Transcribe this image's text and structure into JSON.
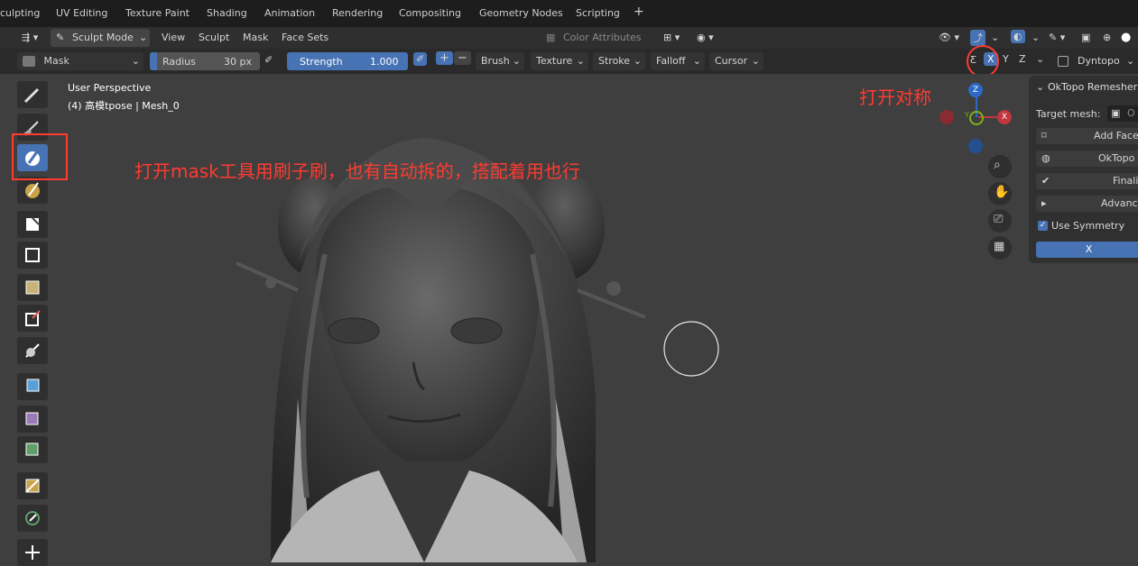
{
  "tabs": [
    "culpting",
    "UV Editing",
    "Texture Paint",
    "Shading",
    "Animation",
    "Rendering",
    "Compositing",
    "Geometry Nodes",
    "Scripting",
    "+"
  ],
  "header": {
    "mode": "Sculpt Mode",
    "menus": [
      "View",
      "Sculpt",
      "Mask",
      "Face Sets"
    ],
    "color_attributes": "Color Attributes"
  },
  "tool_header": {
    "brush_name": "Mask",
    "radius_label": "Radius",
    "radius_value": "30 px",
    "strength_label": "Strength",
    "strength_value": "1.000",
    "plus": "+",
    "minus": "−",
    "dropdowns": [
      "Brush",
      "Texture",
      "Stroke",
      "Falloff",
      "Cursor"
    ],
    "sym_x": "X",
    "sym_y": "Y",
    "sym_z": "Z",
    "dyntopo": "Dyntopo"
  },
  "viewport": {
    "perspective": "User Perspective",
    "object": "(4) 高模tpose | Mesh_0"
  },
  "annotations": {
    "mask_note": "打开mask工具用刷子刷，也有自动拆的，搭配着用也行",
    "sym_note": "打开对称"
  },
  "gizmo": {
    "z": "Z",
    "y": "Y",
    "x": "X"
  },
  "panel": {
    "title": "OkTopo Remesher",
    "target_label": "Target mesh:",
    "target_value": "O",
    "add_face": "Add Face",
    "oktopo": "OkTopo",
    "finalize": "Finali",
    "advanced": "Advanc",
    "use_symmetry": "Use Symmetry",
    "sym_axis": "X"
  },
  "colors": {
    "accent": "#4772b3",
    "annotation": "#ff3b30",
    "x_axis": "#c2373f",
    "y_axis": "#7eb21b",
    "z_axis": "#2d6ac8"
  }
}
